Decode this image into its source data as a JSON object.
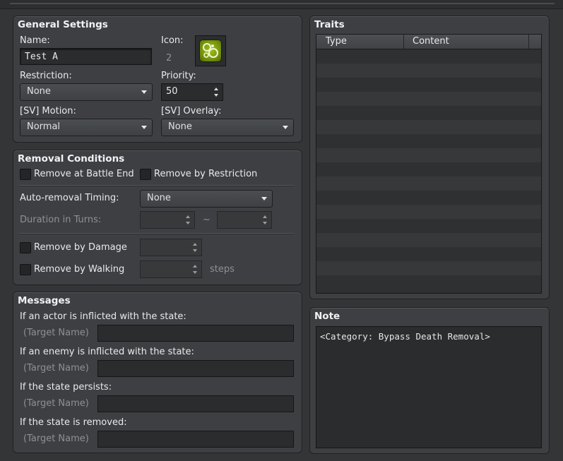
{
  "general": {
    "title": "General Settings",
    "name_label": "Name:",
    "name_value": "Test A",
    "icon_label": "Icon:",
    "icon_index": "2",
    "restriction_label": "Restriction:",
    "restriction_value": "None",
    "priority_label": "Priority:",
    "priority_value": "50",
    "motion_label": "[SV] Motion:",
    "motion_value": "Normal",
    "overlay_label": "[SV] Overlay:",
    "overlay_value": "None"
  },
  "removal": {
    "title": "Removal Conditions",
    "battle_end_label": "Remove at Battle End",
    "restriction_label": "Remove by Restriction",
    "timing_label": "Auto-removal Timing:",
    "timing_value": "None",
    "duration_label": "Duration in Turns:",
    "tilde": "~",
    "damage_label": "Remove by Damage",
    "walking_label": "Remove by Walking",
    "steps_label": "steps"
  },
  "messages": {
    "title": "Messages",
    "actor_label": "If an actor is inflicted with the state:",
    "enemy_label": "If an enemy is inflicted with the state:",
    "persist_label": "If the state persists:",
    "removed_label": "If the state is removed:",
    "target_placeholder": "(Target Name)"
  },
  "traits": {
    "title": "Traits",
    "col_type": "Type",
    "col_content": "Content"
  },
  "note": {
    "title": "Note",
    "text": "<Category: Bypass Death Removal>"
  },
  "colors": {
    "panel": "#3d3f42",
    "input": "#2a2c2e",
    "icon_green": "#8fb014"
  }
}
